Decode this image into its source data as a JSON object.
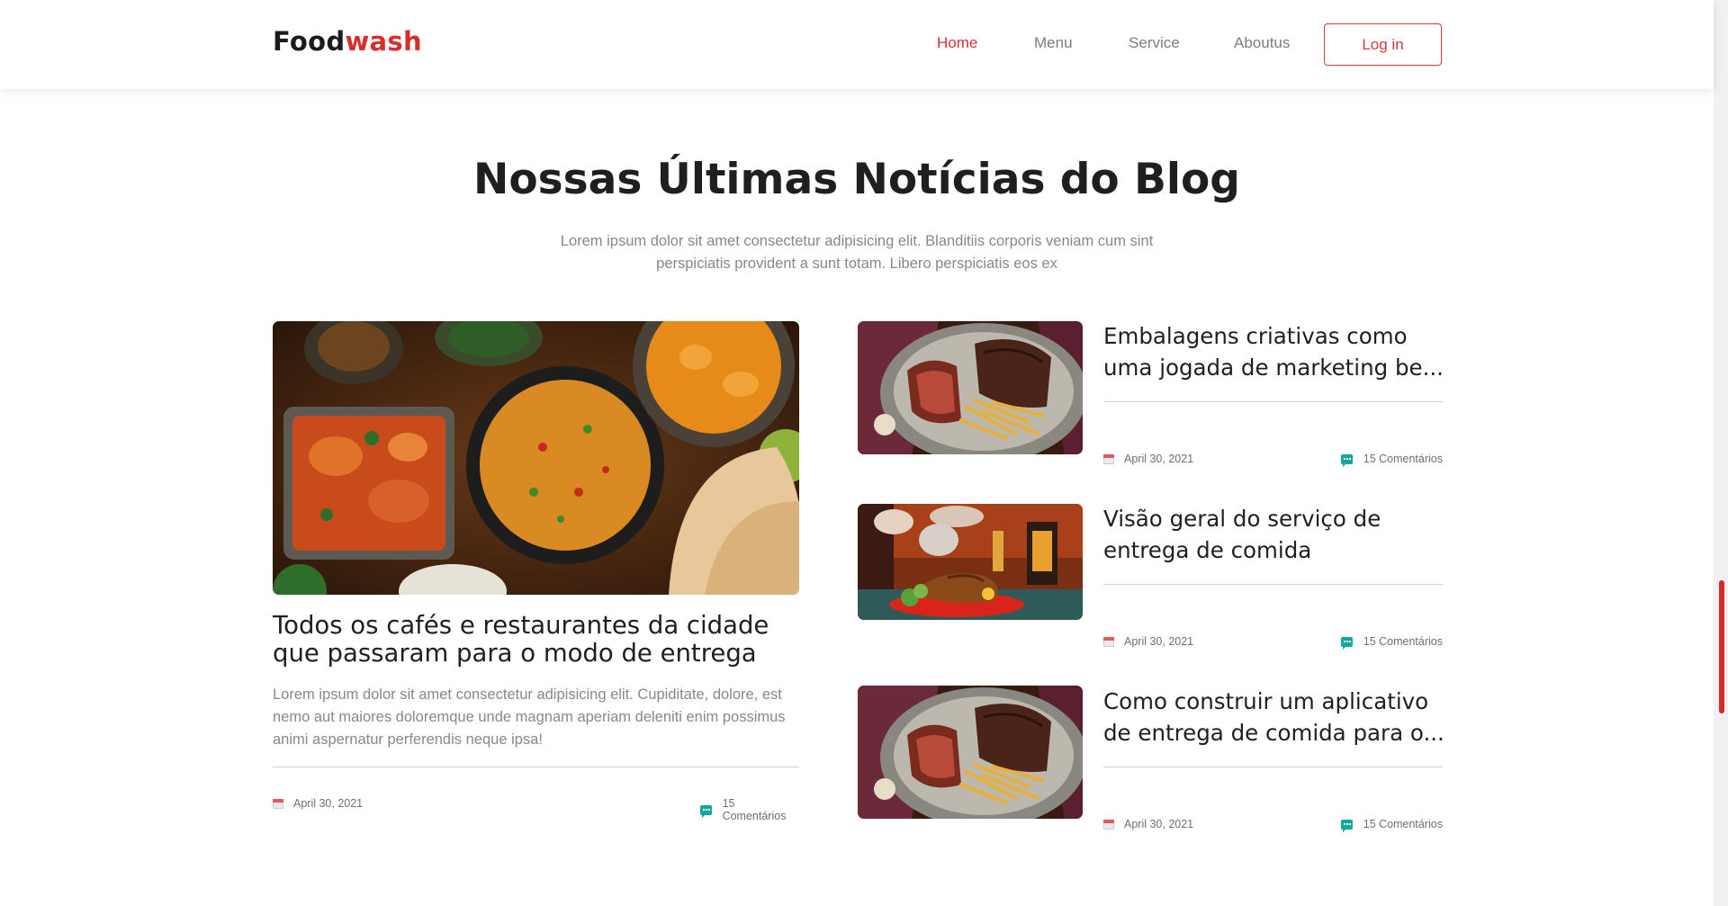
{
  "brand": {
    "part1": "Food",
    "part2": "wash"
  },
  "nav": {
    "items": [
      "Home",
      "Menu",
      "Service",
      "Aboutus"
    ],
    "login": "Log in"
  },
  "section": {
    "title": "Nossas Últimas Notícias do Blog",
    "subtitle_line1": "Lorem ipsum dolor sit amet consectetur adipisicing elit. Blanditiis corporis veniam cum sint",
    "subtitle_line2": "perspiciatis provident a sunt totam. Libero perspiciatis eos ex"
  },
  "featured": {
    "title_line1": "Todos os cafés e restaurantes da cidade",
    "title_line2": "que passaram para o modo de entrega",
    "excerpt_line1": "Lorem ipsum dolor sit amet consectetur adipisicing elit. Cupiditate, dolore, est",
    "excerpt_line2": "nemo aut maiores doloremque unde magnam aperiam deleniti enim possimus",
    "excerpt_line3": "animi aspernatur perferendis neque ipsa!",
    "date": "April 30, 2021",
    "comments": "15 Comentários"
  },
  "posts": [
    {
      "title_line1": "Embalagens criativas como",
      "title_line2": "uma jogada de marketing be...",
      "date": "April 30, 2021",
      "comments": "15 Comentários"
    },
    {
      "title_line1": "Visão geral do serviço de",
      "title_line2": "entrega de comida",
      "date": "April 30, 2021",
      "comments": "15 Comentários"
    },
    {
      "title_line1": "Como construir um aplicativo",
      "title_line2": "de entrega de comida para o...",
      "date": "April 30, 2021",
      "comments": "15 Comentários"
    }
  ],
  "colors": {
    "accent": "#d92c2c",
    "comment_icon": "#13a89e",
    "text_muted": "#888888"
  }
}
